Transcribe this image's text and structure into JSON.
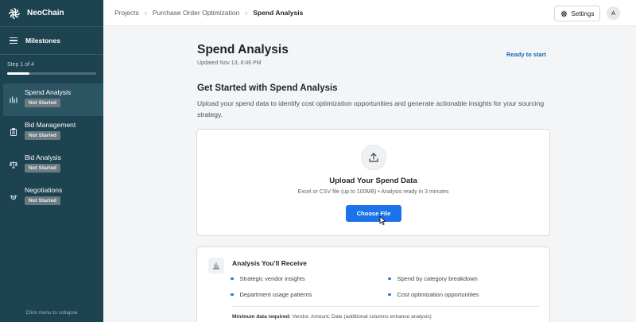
{
  "app": {
    "brand": "NeoChain"
  },
  "sidebar": {
    "milestones_label": "Milestones",
    "step_text": "Step 1 of 4",
    "progress_fraction": 0.25,
    "items": [
      {
        "label": "Spend Analysis",
        "badge": "Not Started",
        "icon": "bar-chart-icon",
        "active": true
      },
      {
        "label": "Bid Management",
        "badge": "Not Started",
        "icon": "clipboard-icon",
        "active": false
      },
      {
        "label": "Bid Analysis",
        "badge": "Not Started",
        "icon": "scale-icon",
        "active": false
      },
      {
        "label": "Negotiations",
        "badge": "Not Started",
        "icon": "handshake-icon",
        "active": false
      }
    ],
    "footer": "Click menu to collapse"
  },
  "topbar": {
    "breadcrumb": [
      "Projects",
      "Purchase Order Optimization",
      "Spend Analysis"
    ],
    "settings_label": "Settings",
    "avatar_initial": "A"
  },
  "main": {
    "title": "Spend Analysis",
    "updated": "Updated Nov 13, 8:46 PM",
    "status_link": "Ready to start",
    "section_title": "Get Started with Spend Analysis",
    "section_desc": "Upload your spend data to identify cost optimization opportunities and generate actionable insights for your sourcing strategy.",
    "upload": {
      "title": "Upload Your Spend Data",
      "subtitle": "Excel or CSV file (up to 100MB) • Analysis ready in 3 minutes",
      "button": "Choose File"
    },
    "analysis": {
      "title": "Analysis You'll Receive",
      "features": [
        "Strategic vendor insights",
        "Spend by category breakdown",
        "Department usage patterns",
        "Cost optimization opportunities"
      ],
      "min_label": "Minimum data required:",
      "min_value": "Vendor, Amount, Date (additional columns enhance analysis)"
    }
  },
  "colors": {
    "sidebar_bg": "#1d4250",
    "accent": "#1a73e8",
    "link": "#1565c0"
  }
}
